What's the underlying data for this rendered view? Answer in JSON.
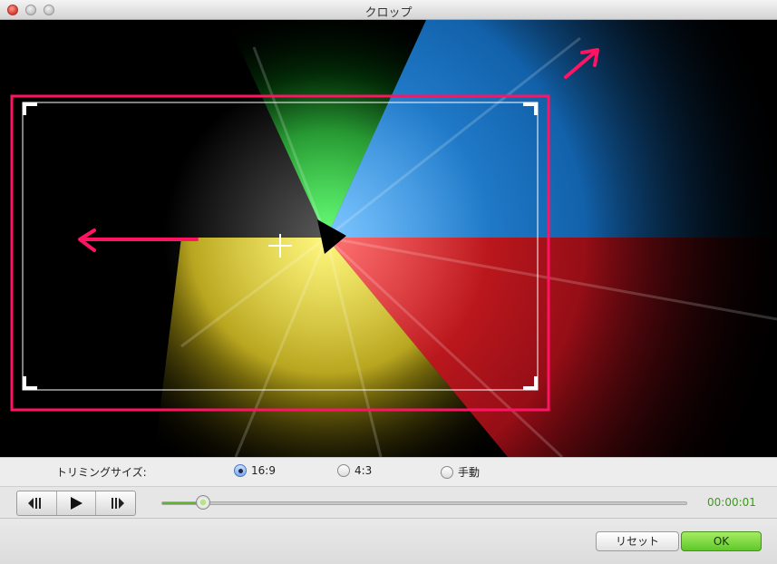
{
  "window": {
    "title": "クロップ"
  },
  "trimming": {
    "label": "トリミングサイズ:",
    "options": [
      {
        "label": "16:9",
        "checked": true
      },
      {
        "label": "4:3",
        "checked": false
      },
      {
        "label": "手動",
        "checked": false
      }
    ]
  },
  "playback": {
    "buttons": [
      "prev-frame-icon",
      "play-icon",
      "next-frame-icon"
    ],
    "progress_fraction": 0.08,
    "timecode": "00:00:01"
  },
  "actions": {
    "reset_label": "リセット",
    "ok_label": "OK"
  },
  "colors": {
    "annotation": "#ff1464",
    "accent_green": "#62b32c",
    "timecode": "#3c9a1c"
  }
}
